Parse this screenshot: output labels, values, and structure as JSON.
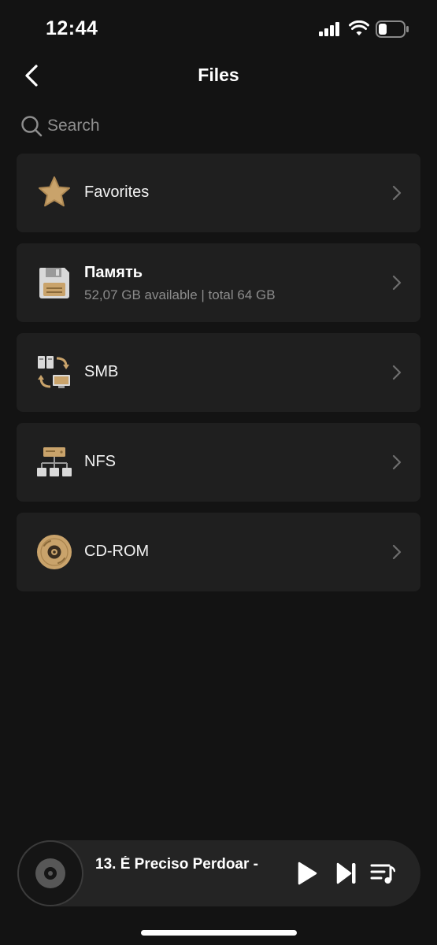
{
  "status_bar": {
    "time": "12:44",
    "icons": [
      "signal-icon",
      "wifi-icon",
      "battery-icon"
    ]
  },
  "header": {
    "title": "Files",
    "back_icon": "chevron-left-icon"
  },
  "search": {
    "placeholder": "Search",
    "icon": "search-icon"
  },
  "sources": [
    {
      "label": "Favorites",
      "icon": "star-icon"
    },
    {
      "label": "Память",
      "subtitle": "52,07 GB available | total 64 GB",
      "icon": "floppy-disk-icon"
    },
    {
      "label": "SMB",
      "icon": "network-share-icon"
    },
    {
      "label": "NFS",
      "icon": "network-tree-icon"
    },
    {
      "label": "CD-ROM",
      "icon": "cd-disc-icon"
    }
  ],
  "player": {
    "track_title": "13. É Preciso Perdoar -",
    "icons": [
      "vinyl-disc-icon",
      "play-icon",
      "next-track-icon",
      "queue-icon"
    ]
  },
  "colors": {
    "background": "#131313",
    "card": "#1f1f1f",
    "accent_gold": "#c9a36b",
    "secondary_text": "#8c8c8c"
  }
}
